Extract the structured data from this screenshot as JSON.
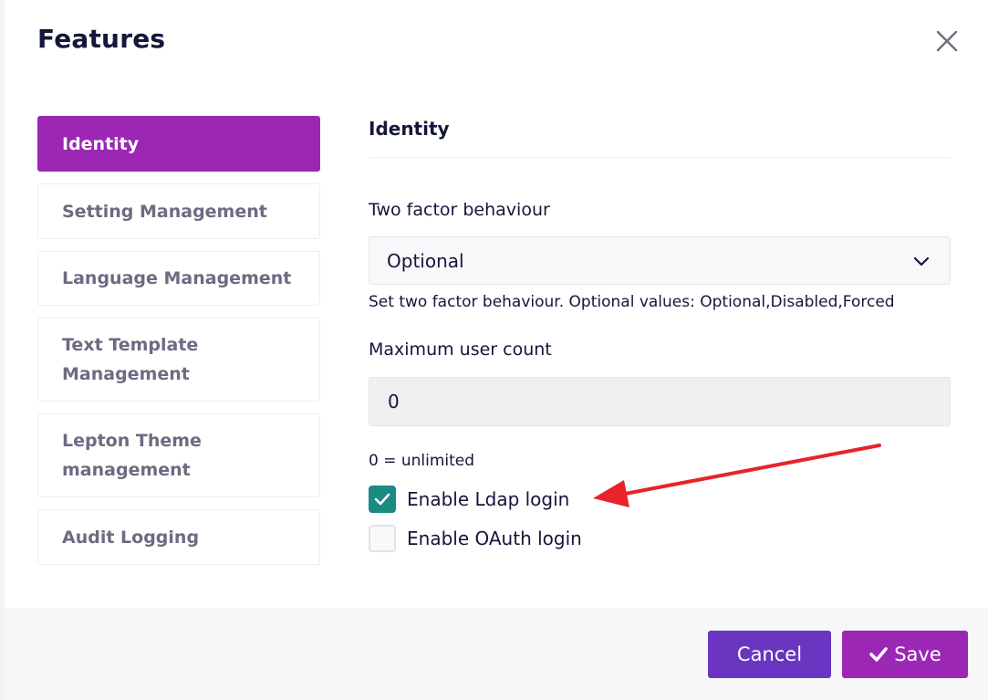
{
  "modal": {
    "title": "Features",
    "close_icon": "close-icon"
  },
  "sidebar": {
    "items": [
      {
        "label": "Identity",
        "active": true
      },
      {
        "label": "Setting Management",
        "active": false
      },
      {
        "label": "Language Management",
        "active": false
      },
      {
        "label": "Text Template Management",
        "active": false
      },
      {
        "label": "Lepton Theme management",
        "active": false
      },
      {
        "label": "Audit Logging",
        "active": false
      }
    ]
  },
  "panel": {
    "title": "Identity",
    "two_factor": {
      "label": "Two factor behaviour",
      "value": "Optional",
      "hint": "Set two factor behaviour. Optional values: Optional,Disabled,Forced"
    },
    "max_users": {
      "label": "Maximum user count",
      "value": "0",
      "hint": "0 = unlimited"
    },
    "ldap": {
      "label": "Enable Ldap login",
      "checked": true
    },
    "oauth": {
      "label": "Enable OAuth login",
      "checked": false
    }
  },
  "footer": {
    "cancel_label": "Cancel",
    "save_label": "Save",
    "save_icon": "check-icon"
  },
  "colors": {
    "accent_purple": "#9b27b4",
    "cancel_violet": "#6a35c0",
    "checkbox_teal": "#1a8a82",
    "annotation_red": "#e8232a"
  }
}
